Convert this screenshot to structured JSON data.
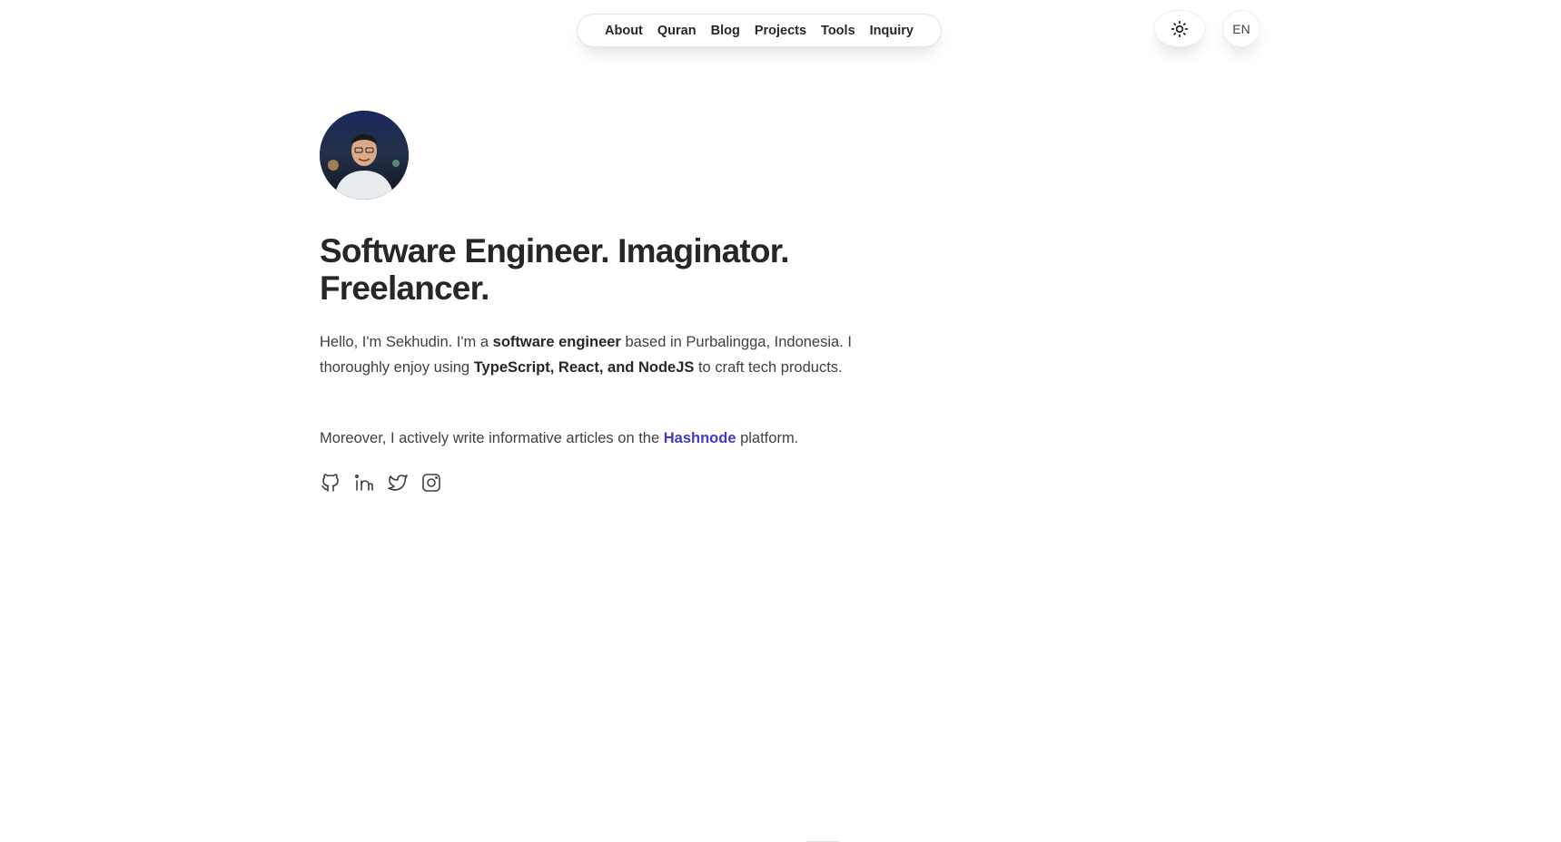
{
  "nav": {
    "items": [
      "About",
      "Quran",
      "Blog",
      "Projects",
      "Tools",
      "Inquiry"
    ]
  },
  "header": {
    "theme_icon": "sun-icon",
    "language": "EN"
  },
  "hero": {
    "avatar_alt": "avatar",
    "headline_line1": "Software Engineer. Imaginator.",
    "headline_line2": "Freelancer.",
    "intro_1": "Hello, I'm Sekhudin. I'm a ",
    "intro_bold_1": "software engineer",
    "intro_2": " based in Purbalingga, Indonesia. I thoroughly enjoy using ",
    "intro_bold_2": "TypeScript, React, and NodeJS",
    "intro_3": " to craft tech products.",
    "articles_1": "Moreover, I actively write informative articles on the ",
    "articles_link": "Hashnode",
    "articles_2": " platform."
  },
  "socials": [
    "github-icon",
    "linkedin-icon",
    "twitter-icon",
    "instagram-icon"
  ],
  "colors": {
    "link": "#4338ca",
    "text": "#27272a"
  }
}
